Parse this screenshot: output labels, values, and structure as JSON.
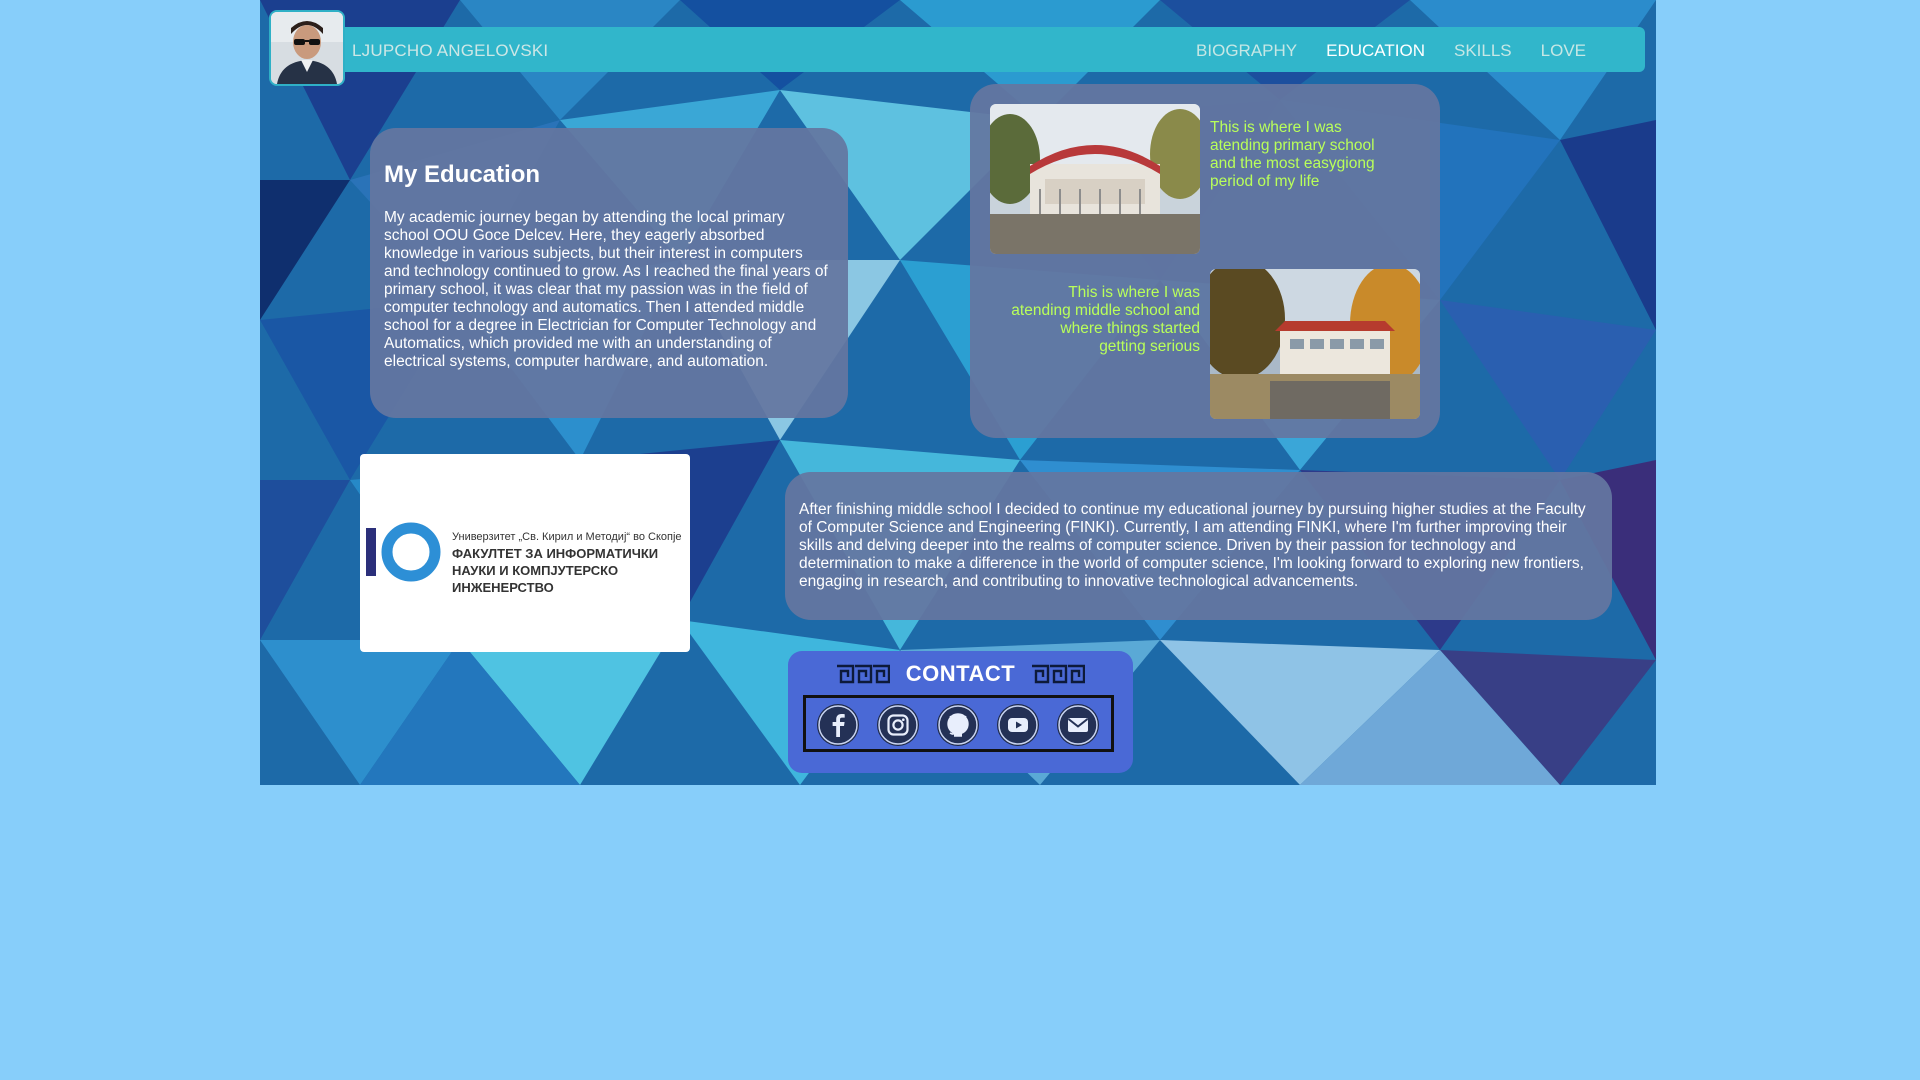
{
  "header": {
    "brand": "LJUPCHO ANGELOVSKI",
    "nav": [
      {
        "label": "BIOGRAPHY",
        "active": false
      },
      {
        "label": "EDUCATION",
        "active": true
      },
      {
        "label": "SKILLS",
        "active": false
      },
      {
        "label": "LOVE",
        "active": false
      }
    ]
  },
  "education": {
    "title": "My Education",
    "text": "My academic journey began by attending the local primary school OOU Goce Delcev. Here, they eagerly absorbed knowledge in various subjects, but their interest in computers and technology continued to grow. As I reached the final years of primary school, it was clear that my passion was in the field of computer technology and automatics. Then I attended middle school for a degree in Electrician for Computer Technology and Automatics, which provided me with an understanding of electrical systems, computer hardware, and automation."
  },
  "schools": {
    "primary_caption": "This is where I was atending primary school and the most easygiong period of my life",
    "middle_caption": "This is where I was atending middle school and where things started getting serious"
  },
  "finki_logo": {
    "line1": "Универзитет „Св. Кирил и Методиј“ во Скопје",
    "line2": "ФАКУЛТЕТ ЗА ИНФОРМАТИЧКИ НАУКИ И КОМПЈУТЕРСКО ИНЖЕНЕРСТВО"
  },
  "higher": {
    "text": "After finishing middle school I decided to continue my educational journey by pursuing higher studies at the Faculty of Computer Science and Engineering (FINKI). Currently, I am attending FINKI, where I'm further improving their skills and delving deeper into the realms of computer science. Driven by their passion for technology and determination to make a difference in the world of computer science, I'm looking forward to exploring new frontiers, engaging in research, and contributing to innovative technological advancements."
  },
  "contact": {
    "title": "CONTACT",
    "icons": [
      "facebook-icon",
      "instagram-icon",
      "github-icon",
      "youtube-icon",
      "email-icon"
    ]
  },
  "colors": {
    "page_background": "#87cefa",
    "navbar": "#31b6cb",
    "card": "#6476a0",
    "caption": "#b9ff5a",
    "contact": "#4a69d6"
  }
}
